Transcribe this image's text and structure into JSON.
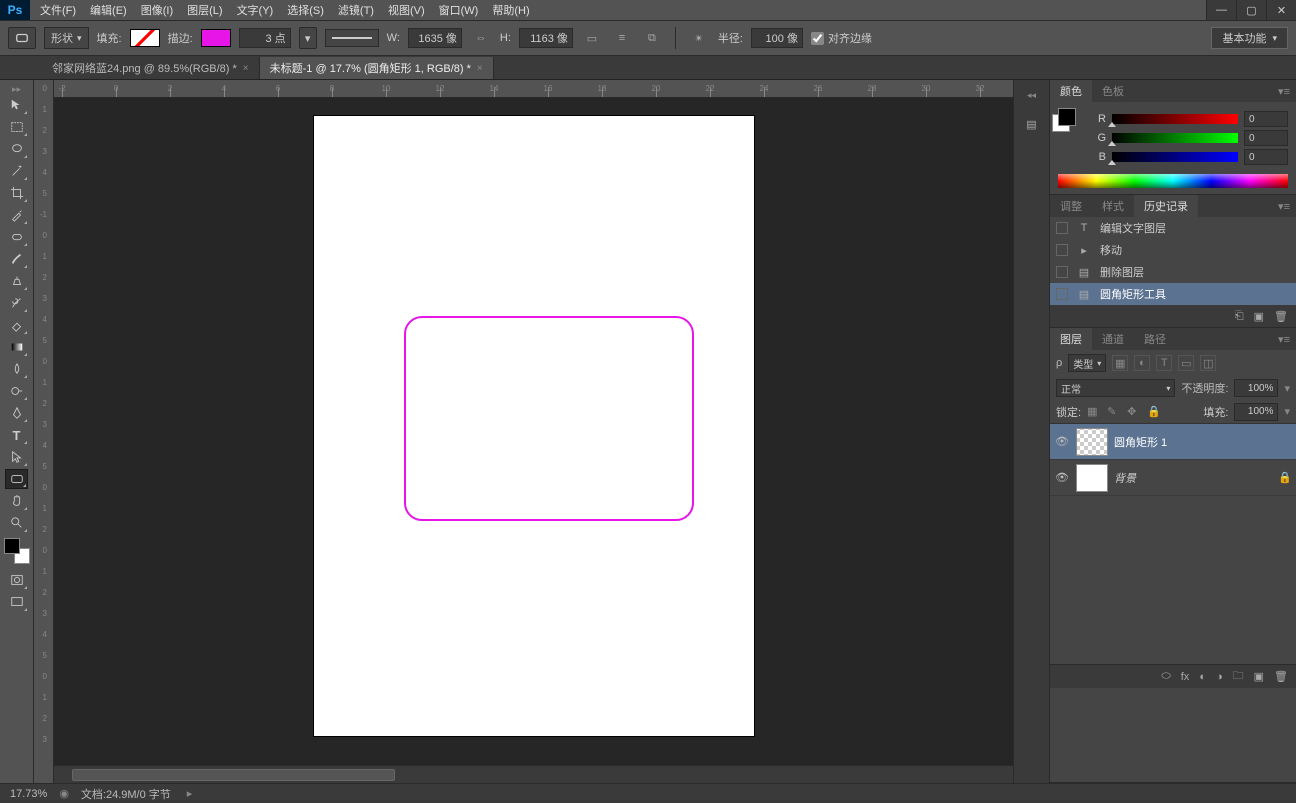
{
  "app": {
    "logo": "Ps"
  },
  "menu": [
    "文件(F)",
    "编辑(E)",
    "图像(I)",
    "图层(L)",
    "文字(Y)",
    "选择(S)",
    "滤镜(T)",
    "视图(V)",
    "窗口(W)",
    "帮助(H)"
  ],
  "options": {
    "mode": "形状",
    "fill_label": "填充:",
    "stroke_label": "描边:",
    "stroke_width": "3 点",
    "w_label": "W:",
    "w_value": "1635 像",
    "h_label": "H:",
    "h_value": "1163 像",
    "radius_label": "半径:",
    "radius_value": "100 像",
    "align_edges": "对齐边缘",
    "workspace": "基本功能"
  },
  "tabs": [
    {
      "label": "邻家网络蓝24.png @ 89.5%(RGB/8) *",
      "active": false
    },
    {
      "label": "未标题-1 @ 17.7% (圆角矩形 1, RGB/8) *",
      "active": true
    }
  ],
  "ruler_top": [
    "-2",
    "0",
    "2",
    "4",
    "6",
    "8",
    "10",
    "12",
    "14",
    "16",
    "18",
    "20",
    "22",
    "24",
    "26",
    "28",
    "30",
    "32"
  ],
  "ruler_left": [
    "0",
    "1",
    "2",
    "3",
    "4",
    "5",
    "-1",
    "0",
    "1",
    "2",
    "3",
    "4",
    "5",
    "0",
    "1",
    "2",
    "3",
    "4",
    "5",
    "0",
    "1",
    "2",
    "0",
    "1",
    "2",
    "3",
    "4",
    "5",
    "0",
    "1",
    "2",
    "3"
  ],
  "status": {
    "zoom": "17.73%",
    "doc_label": "文档:",
    "doc_info": "24.9M/0 字节"
  },
  "panels": {
    "color": {
      "tab1": "颜色",
      "tab2": "色板",
      "r": "0",
      "g": "0",
      "b": "0",
      "r_label": "R",
      "g_label": "G",
      "b_label": "B"
    },
    "history": {
      "tab1": "调整",
      "tab2": "样式",
      "tab3": "历史记录",
      "items": [
        {
          "icon": "T",
          "label": "编辑文字图层"
        },
        {
          "icon": "▸",
          "label": "移动"
        },
        {
          "icon": "▤",
          "label": "删除图层"
        },
        {
          "icon": "▤",
          "label": "圆角矩形工具"
        }
      ]
    },
    "layers": {
      "tab1": "图层",
      "tab2": "通道",
      "tab3": "路径",
      "filter_label": "类型",
      "blend_mode": "正常",
      "opacity_label": "不透明度:",
      "opacity": "100%",
      "lock_label": "锁定:",
      "fill_label": "填充:",
      "fill_value": "100%",
      "items": [
        {
          "name": "圆角矩形 1",
          "selected": true,
          "transparent": true,
          "locked": false
        },
        {
          "name": "背景",
          "selected": false,
          "transparent": false,
          "locked": true
        }
      ]
    }
  }
}
